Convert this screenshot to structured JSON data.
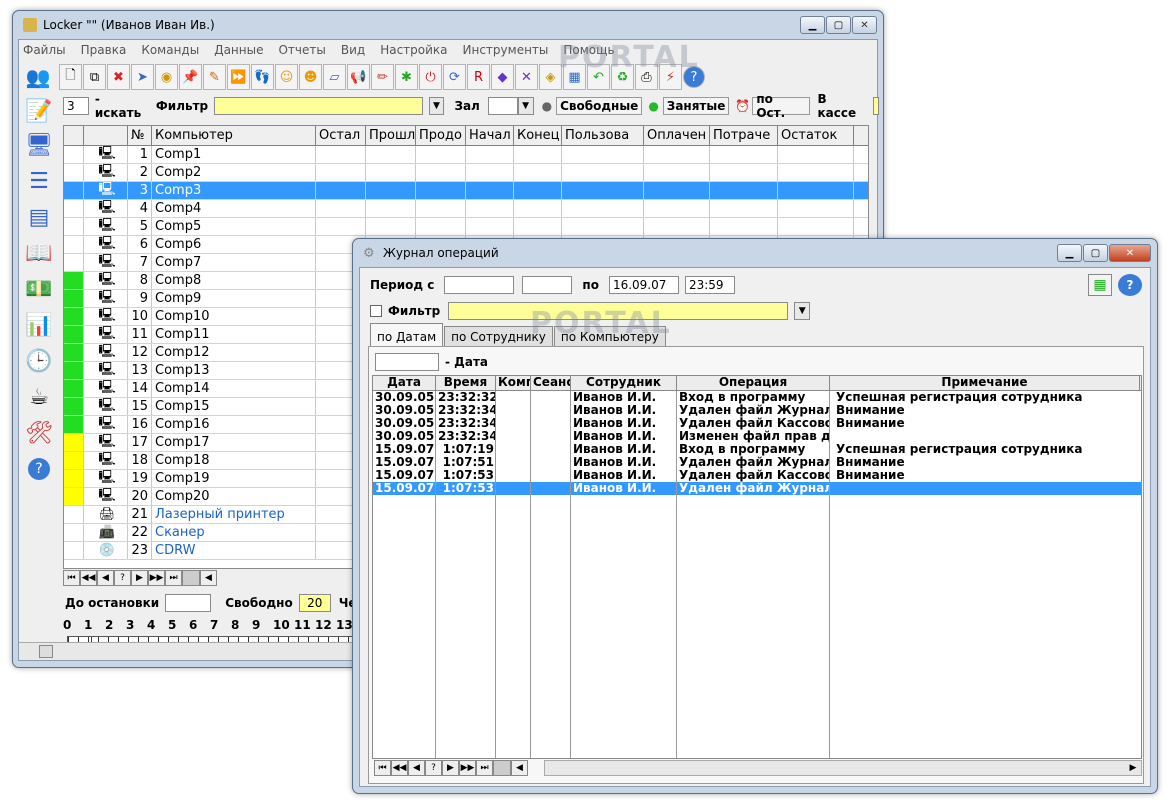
{
  "main": {
    "title": "Locker  \"\"  (Иванов Иван Ив.)",
    "menu": [
      "Файлы",
      "Правка",
      "Команды",
      "Данные",
      "Отчеты",
      "Вид",
      "Настройка",
      "Инструменты",
      "Помощь"
    ],
    "filter": {
      "count": "3",
      "search_label": "- искать",
      "filter_label": "Фильтр",
      "hall_label": "Зал",
      "free_label": "Свободные",
      "busy_label": "Занятые",
      "by_stop_label": "по Ост.",
      "cashbox_label": "В кассе"
    },
    "grid": {
      "headers": [
        "№",
        "Компьютер",
        "Остал",
        "Прошл",
        "Продо",
        "Начал",
        "Конец",
        "Пользова",
        "Оплачен",
        "Потраче",
        "Остаток"
      ],
      "rows": [
        {
          "n": "1",
          "name": "Comp1",
          "status": ""
        },
        {
          "n": "2",
          "name": "Comp2",
          "status": ""
        },
        {
          "n": "3",
          "name": "Comp3",
          "status": "selected"
        },
        {
          "n": "4",
          "name": "Comp4",
          "status": ""
        },
        {
          "n": "5",
          "name": "Comp5",
          "status": ""
        },
        {
          "n": "6",
          "name": "Comp6",
          "status": ""
        },
        {
          "n": "7",
          "name": "Comp7",
          "status": ""
        },
        {
          "n": "8",
          "name": "Comp8",
          "status": "green"
        },
        {
          "n": "9",
          "name": "Comp9",
          "status": "green"
        },
        {
          "n": "10",
          "name": "Comp10",
          "status": "green"
        },
        {
          "n": "11",
          "name": "Comp11",
          "status": "green"
        },
        {
          "n": "12",
          "name": "Comp12",
          "status": "green"
        },
        {
          "n": "13",
          "name": "Comp13",
          "status": "green"
        },
        {
          "n": "14",
          "name": "Comp14",
          "status": "green"
        },
        {
          "n": "15",
          "name": "Comp15",
          "status": "green"
        },
        {
          "n": "16",
          "name": "Comp16",
          "status": "green"
        },
        {
          "n": "17",
          "name": "Comp17",
          "status": "yellow"
        },
        {
          "n": "18",
          "name": "Comp18",
          "status": "yellow"
        },
        {
          "n": "19",
          "name": "Comp19",
          "status": "yellow"
        },
        {
          "n": "20",
          "name": "Comp20",
          "status": "yellow"
        },
        {
          "n": "21",
          "name": "Лазерный принтер",
          "status": "device"
        },
        {
          "n": "22",
          "name": "Сканер",
          "status": "device"
        },
        {
          "n": "23",
          "name": "CDRW",
          "status": "device"
        }
      ]
    },
    "bottom": {
      "until_stop_label": "До остановки",
      "free_label": "Свободно",
      "free_value": "20",
      "through_label": "Через",
      "ruler": [
        "0",
        "1",
        "2",
        "3",
        "4",
        "5",
        "6",
        "7",
        "8",
        "9",
        "10",
        "11",
        "12",
        "13"
      ]
    }
  },
  "journal": {
    "title": "Журнал операций",
    "period_label": "Период с",
    "to_label": "по",
    "to_date": "16.09.07",
    "to_time": "23:59",
    "filter_label": "Фильтр",
    "tabs": [
      "по Датам",
      "по Сотруднику",
      "по Компьютеру"
    ],
    "date_label": "- Дата",
    "headers": [
      "Дата",
      "Время",
      "Компь",
      "Сеанс",
      "Сотрудник",
      "Операция",
      "Примечание"
    ],
    "rows": [
      [
        "30.09.05",
        "23:32:32",
        "",
        "",
        "Иванов И.И.",
        "Вход в программу",
        "Успешная регистрация сотрудника"
      ],
      [
        "30.09.05",
        "23:32:34",
        "",
        "",
        "Иванов И.И.",
        "Удален файл Журнала Се",
        "Внимание"
      ],
      [
        "30.09.05",
        "23:32:34",
        "",
        "",
        "Иванов И.И.",
        "Удален файл Кассовой к",
        "Внимание"
      ],
      [
        "30.09.05",
        "23:32:34",
        "",
        "",
        "Иванов И.И.",
        "Изменен файл прав дост",
        ""
      ],
      [
        "15.09.07",
        "1:07:19",
        "",
        "",
        "Иванов И.И.",
        "Вход в программу",
        "Успешная регистрация сотрудника"
      ],
      [
        "15.09.07",
        "1:07:51",
        "",
        "",
        "Иванов И.И.",
        "Удален файл Журнала Се",
        "Внимание"
      ],
      [
        "15.09.07",
        "1:07:53",
        "",
        "",
        "Иванов И.И.",
        "Удален файл Кассовой к",
        "Внимание"
      ],
      [
        "15.09.07",
        "1:07:53",
        "",
        "",
        "Иванов И.И.",
        "Удален файл Журнала Оп",
        ""
      ]
    ],
    "selected_row": 7
  },
  "watermark": "PORTAL"
}
